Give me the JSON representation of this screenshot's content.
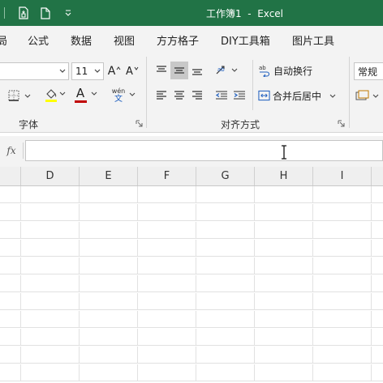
{
  "window": {
    "title": "工作簿1  -  Excel",
    "title_bar_color": "#217346"
  },
  "quick_access": {
    "icons": [
      "save-cloud-icon",
      "new-document-icon",
      "customize-chevron-icon"
    ]
  },
  "menu": {
    "tabs": [
      "局",
      "公式",
      "数据",
      "视图",
      "方方格子",
      "DIY工具箱",
      "图片工具"
    ]
  },
  "ribbon": {
    "font": {
      "font_size": "11",
      "increase_size_label": "A",
      "decrease_size_label": "A",
      "pinyin_top": "wén",
      "pinyin_bottom": "文",
      "font_color_letter": "A",
      "highlight_color": "#ffff00",
      "font_color": "#c00000",
      "group_label": "字体"
    },
    "alignment": {
      "wrap_text_label": "自动换行",
      "merge_center_label": "合并后居中",
      "wrap_icon_text": "ab",
      "group_label": "对齐方式"
    },
    "number": {
      "format_value": "常规"
    }
  },
  "formula_bar": {
    "fx_label": "fx",
    "value": ""
  },
  "sheet": {
    "columns": [
      "D",
      "E",
      "F",
      "G",
      "H",
      "I"
    ],
    "row_count": 11
  }
}
